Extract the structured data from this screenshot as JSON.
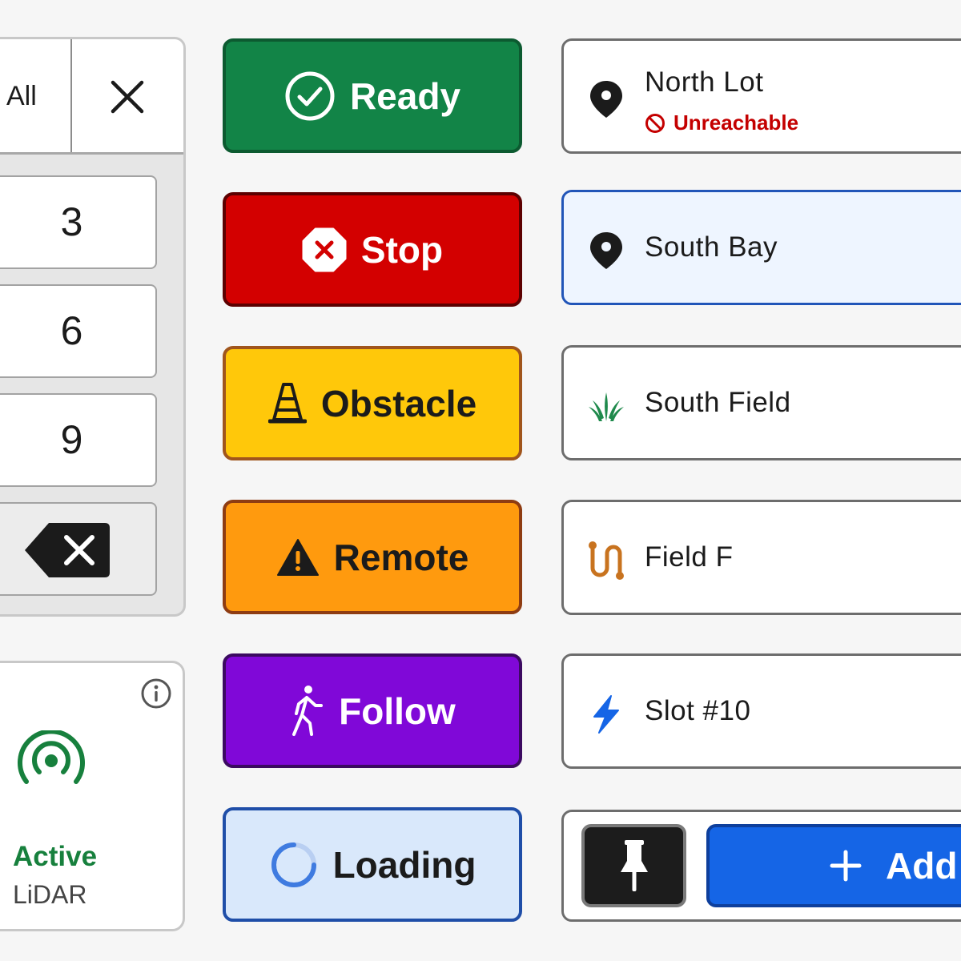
{
  "keypad": {
    "header_label": "All",
    "keys": [
      "3",
      "6",
      "9"
    ],
    "close_icon": "close-icon",
    "backspace_icon": "backspace-icon"
  },
  "sensor": {
    "status": "Active",
    "label": "LiDAR",
    "status_color": "#17803d",
    "icon": "radar-signal-icon"
  },
  "status_buttons": [
    {
      "label": "Ready",
      "icon": "check-circle-icon",
      "color": "#128447"
    },
    {
      "label": "Stop",
      "icon": "stop-octagon-icon",
      "color": "#d30000"
    },
    {
      "label": "Obstacle",
      "icon": "traffic-cone-icon",
      "color": "#ffc80a"
    },
    {
      "label": "Remote",
      "icon": "warning-triangle-icon",
      "color": "#ff9a0e"
    },
    {
      "label": "Follow",
      "icon": "walking-person-icon",
      "color": "#8008d8"
    },
    {
      "label": "Loading",
      "icon": "spinner-icon",
      "color": "#d9e8fb"
    }
  ],
  "locations": [
    {
      "name": "North Lot",
      "icon": "map-pin-icon",
      "status": "Unreachable",
      "status_icon": "blocked-icon",
      "status_color": "#c40000"
    },
    {
      "name": "South Bay",
      "icon": "map-pin-icon",
      "selected": true
    },
    {
      "name": "South Field",
      "icon": "grass-icon",
      "icon_color": "#1f8a4c"
    },
    {
      "name": "Field F",
      "icon": "route-icon",
      "icon_color": "#c8731f"
    },
    {
      "name": "Slot #10",
      "icon": "lightning-icon",
      "icon_color": "#1565e6"
    }
  ],
  "toolbar": {
    "pin_icon": "pushpin-icon",
    "add_label": "Add",
    "add_icon": "plus-icon",
    "accent": "#1565e6"
  }
}
